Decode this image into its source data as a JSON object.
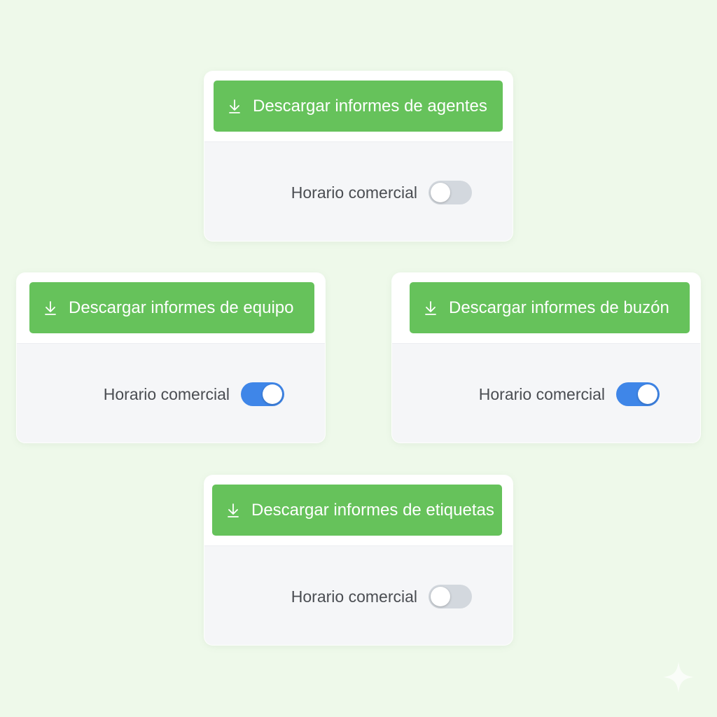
{
  "colors": {
    "background": "#eef9ea",
    "card_body": "#f5f6f8",
    "button_green": "#66c25b",
    "toggle_on": "#3f86e8",
    "toggle_off": "#d3d8de",
    "label_text": "#4a4d52"
  },
  "cards": [
    {
      "button_label": "Descargar informes de agentes",
      "button_icon": "download-icon",
      "toggle_label": "Horario comercial",
      "toggle_state": "off"
    },
    {
      "button_label": "Descargar informes de equipo",
      "button_icon": "download-icon",
      "toggle_label": "Horario comercial",
      "toggle_state": "on"
    },
    {
      "button_label": "Descargar informes de buzón",
      "button_icon": "download-icon",
      "toggle_label": "Horario comercial",
      "toggle_state": "on"
    },
    {
      "button_label": "Descargar informes de etiquetas",
      "button_icon": "download-icon",
      "toggle_label": "Horario comercial",
      "toggle_state": "off"
    }
  ],
  "decoration": {
    "corner_icon": "sparkle-icon"
  }
}
